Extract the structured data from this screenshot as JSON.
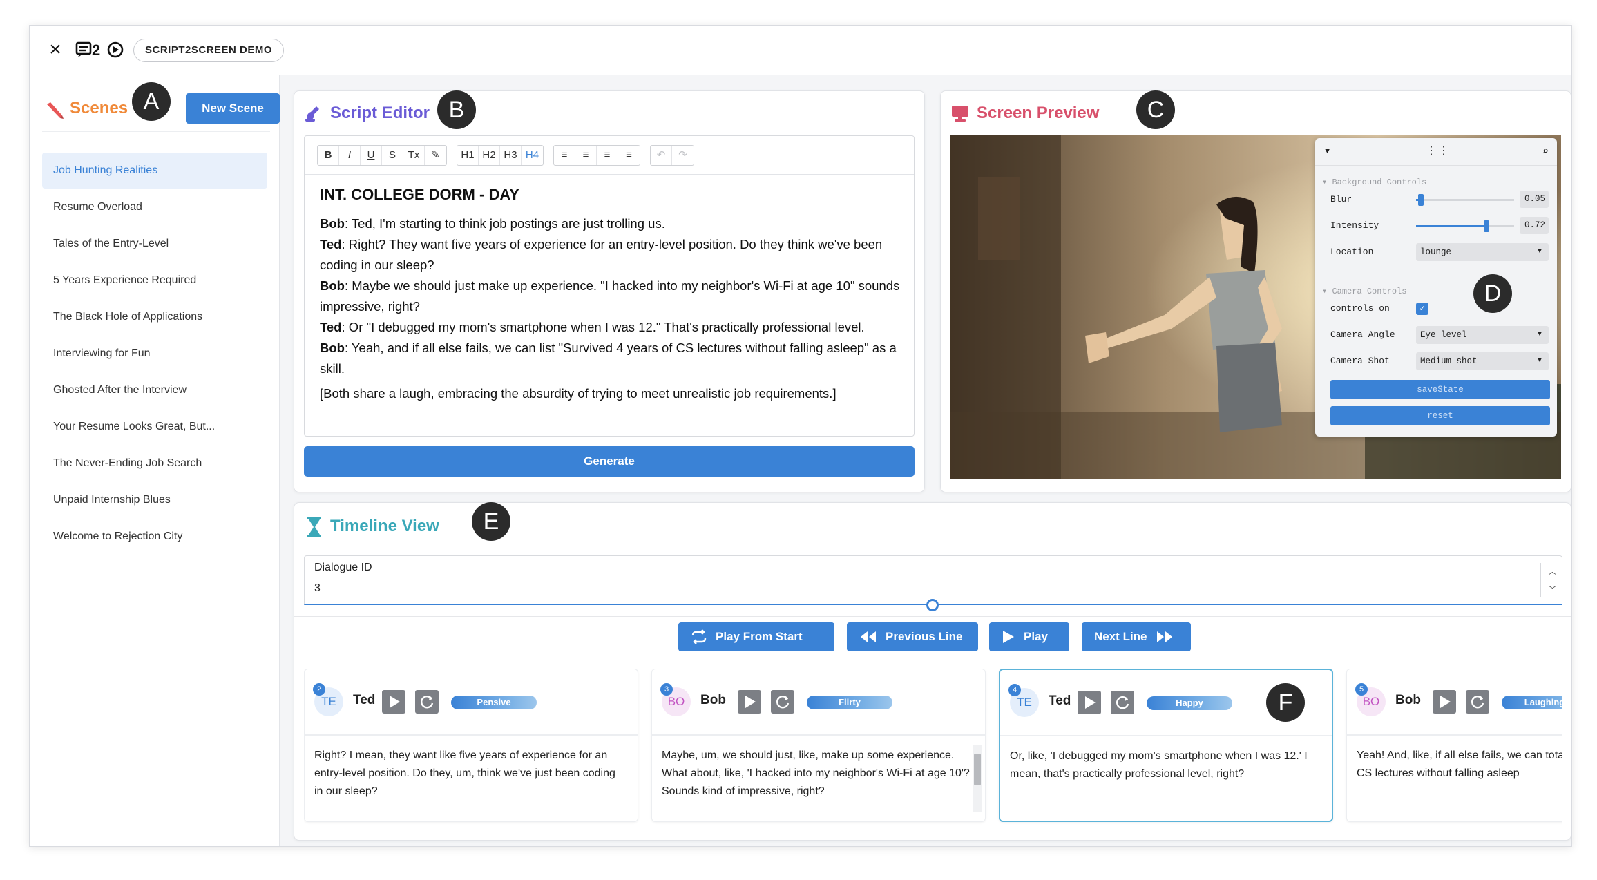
{
  "topbar": {
    "demo_label": "SCRIPT2SCREEN DEMO"
  },
  "markers": {
    "a": "A",
    "b": "B",
    "c": "C",
    "d": "D",
    "e": "E",
    "f": "F"
  },
  "scenes": {
    "title": "Scenes",
    "new_button": "New Scene",
    "items": [
      "Job Hunting Realities",
      "Resume Overload",
      "Tales of the Entry-Level",
      "5 Years Experience Required",
      "The Black Hole of Applications",
      "Interviewing for Fun",
      "Ghosted After the Interview",
      "Your Resume Looks Great, But...",
      "The Never-Ending Job Search",
      "Unpaid Internship Blues",
      "Welcome to Rejection City"
    ],
    "active_index": 0
  },
  "editor": {
    "title": "Script Editor",
    "toolbar": {
      "format": [
        "B",
        "I",
        "U",
        "S",
        "Tx",
        "✎"
      ],
      "headings": [
        "H1",
        "H2",
        "H3",
        "H4"
      ],
      "align": [
        "≡",
        "≡",
        "≡",
        "≡"
      ],
      "history": [
        "↶",
        "↷"
      ]
    },
    "heading": "INT. COLLEGE DORM - DAY",
    "lines": [
      {
        "speaker": "Bob",
        "text": ": Ted, I'm starting to think job postings are just trolling us."
      },
      {
        "speaker": "Ted",
        "text": ": Right? They want five years of experience for an entry-level position. Do they think we've been coding in our sleep?"
      },
      {
        "speaker": "Bob",
        "text": ": Maybe we should just make up experience. \"I hacked into my neighbor's Wi-Fi at age 10\" sounds impressive, right?"
      },
      {
        "speaker": "Ted",
        "text": ": Or \"I debugged my mom's smartphone when I was 12.\" That's practically professional level."
      },
      {
        "speaker": "Bob",
        "text": ": Yeah, and if all else fails, we can list \"Survived 4 years of CS lectures without falling asleep\" as a skill."
      }
    ],
    "note": "[Both share a laugh, embracing the absurdity of trying to meet unrealistic job requirements.]",
    "generate_label": "Generate"
  },
  "preview": {
    "title": "Screen Preview",
    "controls": {
      "background_section": "Background Controls",
      "blur_label": "Blur",
      "blur_value": "0.05",
      "blur_fraction": 0.05,
      "intensity_label": "Intensity",
      "intensity_value": "0.72",
      "intensity_fraction": 0.72,
      "location_label": "Location",
      "location_value": "lounge",
      "camera_section": "Camera Controls",
      "controls_on_label": "controls on",
      "camera_angle_label": "Camera Angle",
      "camera_angle_value": "Eye level",
      "camera_shot_label": "Camera Shot",
      "camera_shot_value": "Medium shot",
      "save_label": "saveState",
      "reset_label": "reset"
    }
  },
  "timeline": {
    "title": "Timeline View",
    "dialogue_label": "Dialogue ID",
    "dialogue_value": "3",
    "buttons": {
      "play_from_start": "Play From Start",
      "previous_line": "Previous Line",
      "play": "Play",
      "next_line": "Next Line"
    },
    "cards": [
      {
        "num": "2",
        "initials": "TE",
        "speaker": "Ted",
        "emotion": "Pensive",
        "text": "Right? I mean, they want like five years of experience for an entry-level position. Do they, um, think we've just been coding in our sleep?"
      },
      {
        "num": "3",
        "initials": "BO",
        "speaker": "Bob",
        "emotion": "Flirty",
        "text": "Maybe, um, we should just, like, make up some experience. What about, like, 'I hacked into my neighbor's Wi-Fi at age 10'? Sounds kind of impressive, right?"
      },
      {
        "num": "4",
        "initials": "TE",
        "speaker": "Ted",
        "emotion": "Happy",
        "text": "Or, like, 'I debugged my mom's smartphone when I was 12.' I mean, that's practically professional level, right?"
      },
      {
        "num": "5",
        "initials": "BO",
        "speaker": "Bob",
        "emotion": "Laughing",
        "text": "Yeah! And, like, if all else fails, we can totally list four years of CS lectures without falling asleep"
      }
    ],
    "selected_card": 2
  },
  "colors": {
    "accent": "#3a82d6",
    "scenes_title": "#f08a3a",
    "editor_title": "#6a5bd6",
    "preview_title": "#d8506b",
    "timeline_title": "#3aa8b8"
  }
}
